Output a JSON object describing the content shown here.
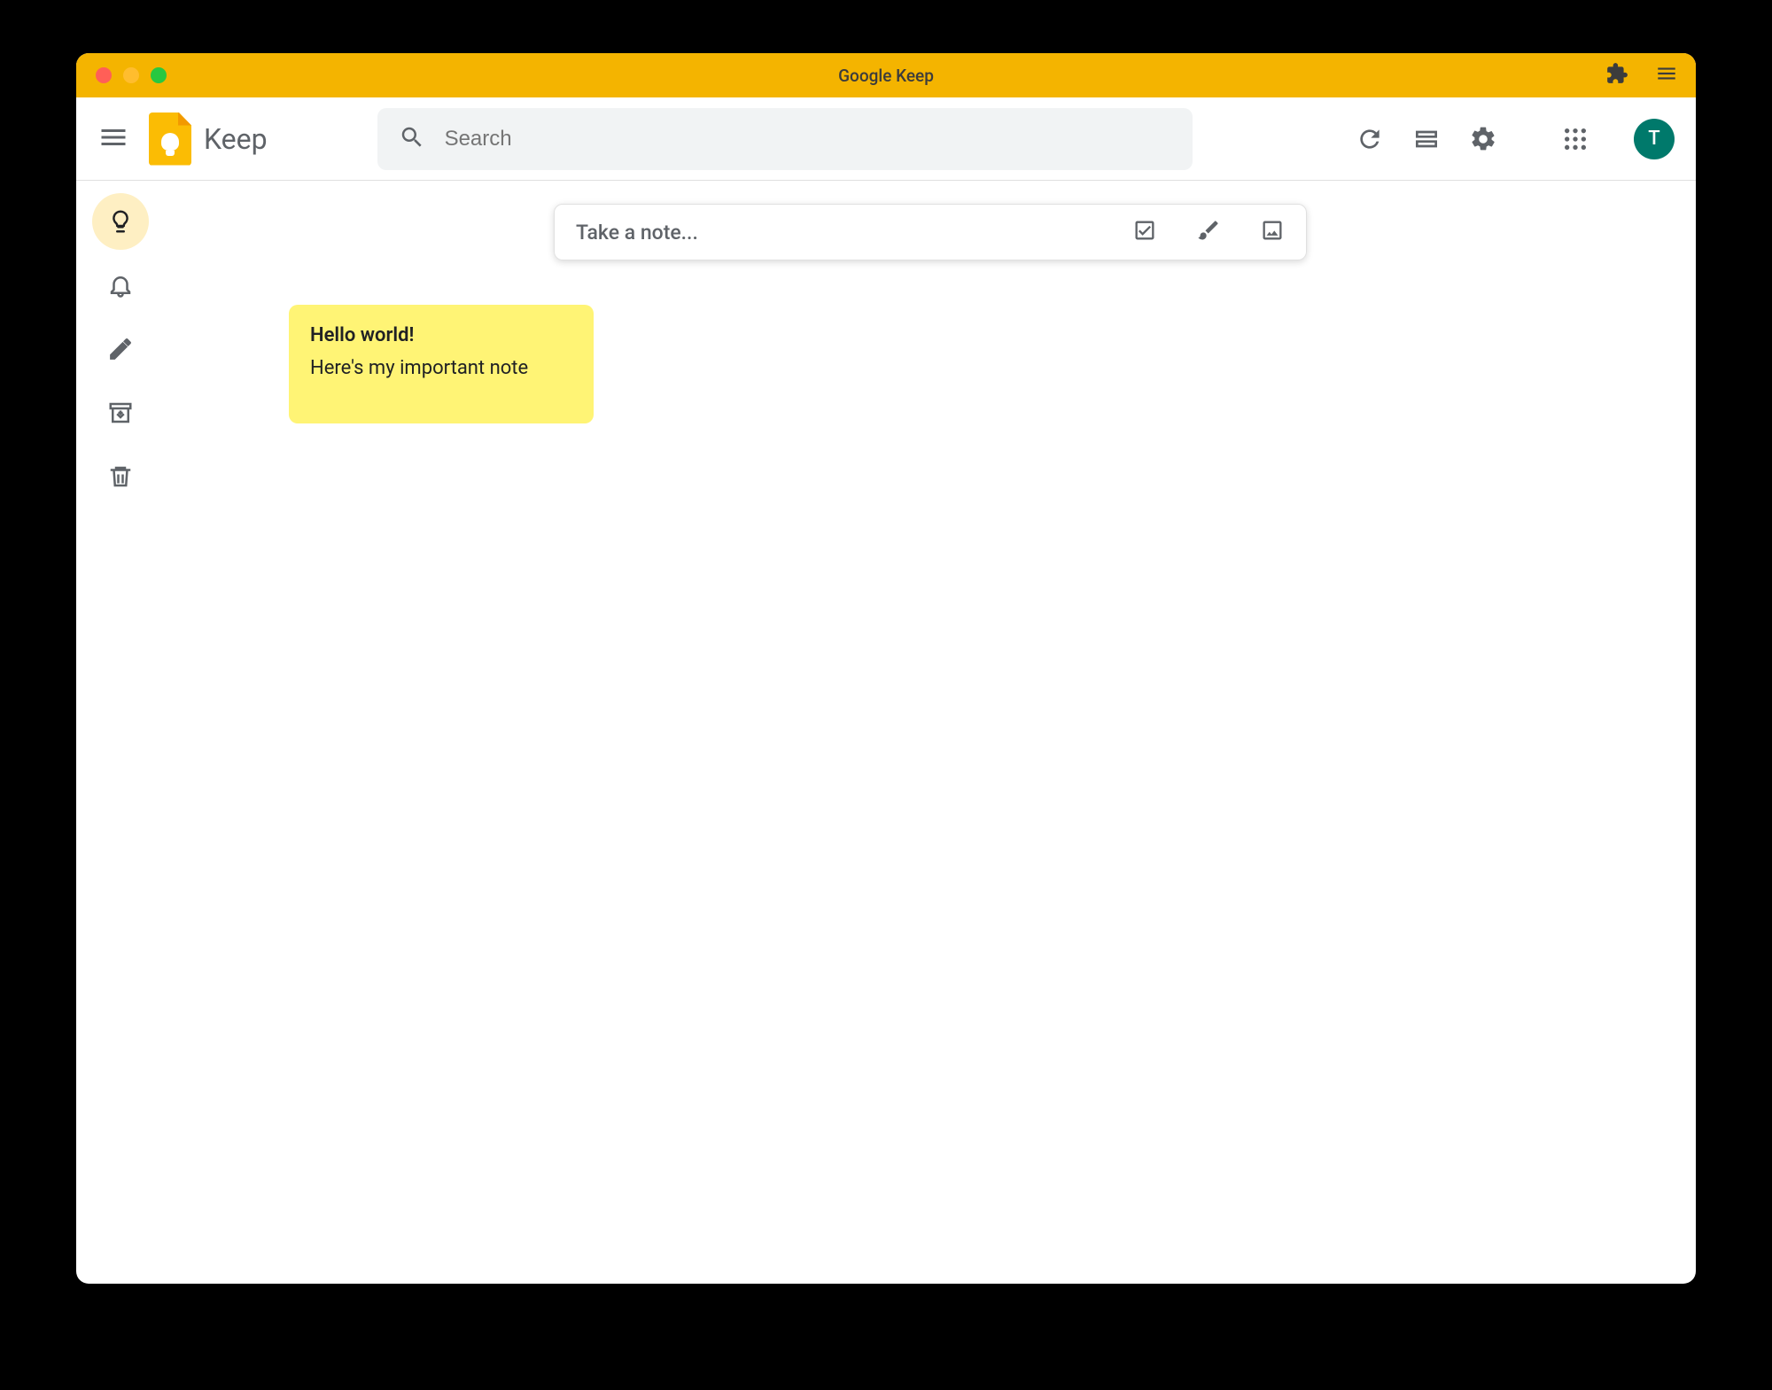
{
  "window": {
    "title": "Google Keep"
  },
  "header": {
    "app_name": "Keep",
    "search_placeholder": "Search",
    "avatar_initial": "T"
  },
  "take_note": {
    "placeholder": "Take a note..."
  },
  "sidebar": {
    "items": [
      {
        "id": "notes",
        "icon": "lightbulb",
        "active": true
      },
      {
        "id": "reminders",
        "icon": "bell",
        "active": false
      },
      {
        "id": "edit-labels",
        "icon": "pencil",
        "active": false
      },
      {
        "id": "archive",
        "icon": "archive",
        "active": false
      },
      {
        "id": "trash",
        "icon": "trash",
        "active": false
      }
    ]
  },
  "notes": [
    {
      "title": "Hello world!",
      "body": "Here's my important note",
      "color": "#fff475"
    }
  ],
  "colors": {
    "brand_yellow": "#f4b400",
    "note_yellow": "#fff475",
    "avatar_bg": "#00796b"
  }
}
